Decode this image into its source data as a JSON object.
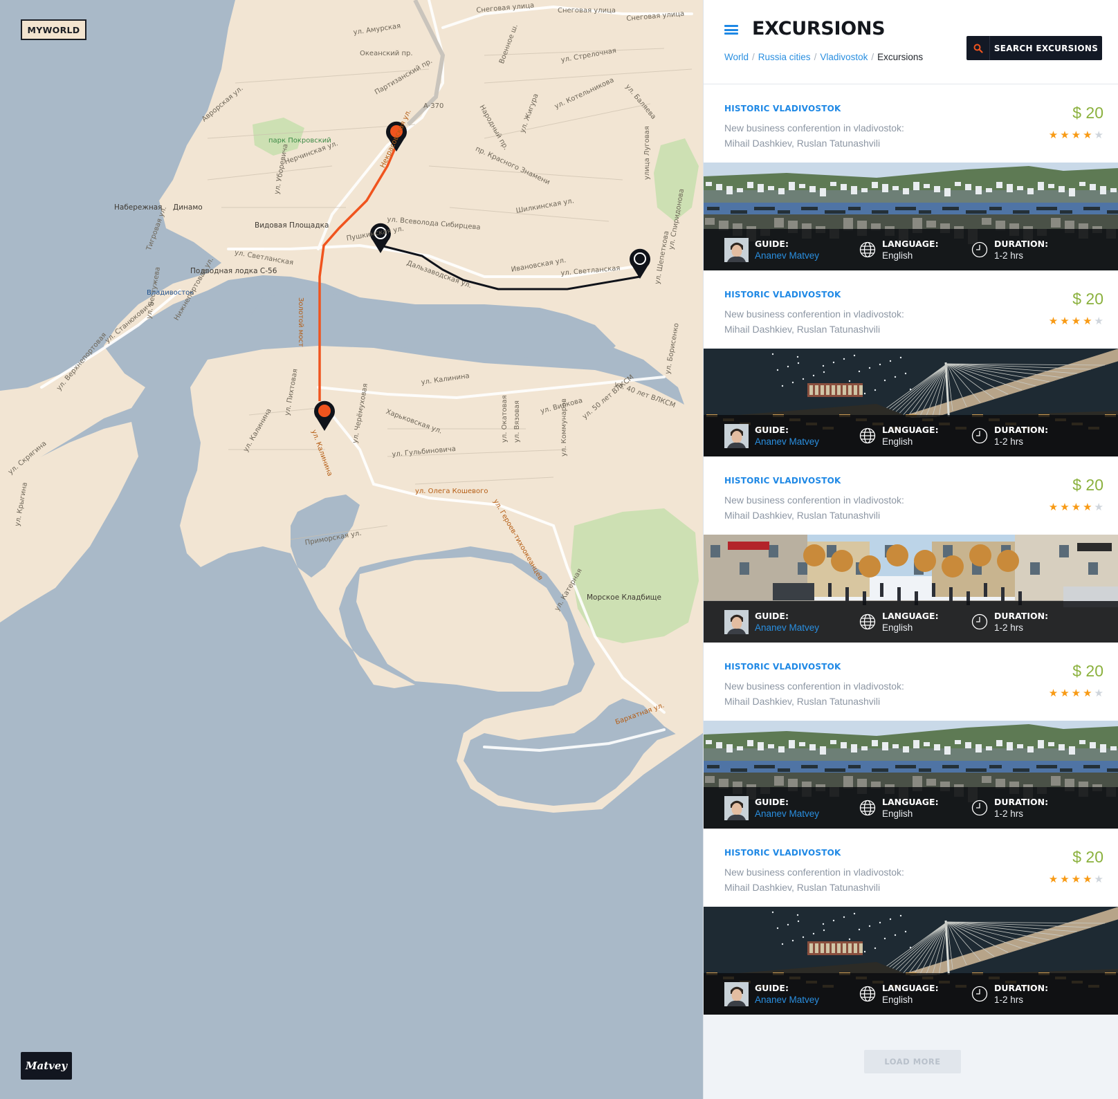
{
  "map": {
    "logo": "MYWORLD",
    "signature": "Matvey",
    "labels": [
      "Снеговая улица",
      "Снеговая улица",
      "Снеговая улица",
      "ул. Амурская",
      "Океанский пр.",
      "Партизанский пр.",
      "A-370",
      "Аврорская ул.",
      "парк Покровский",
      "Нерчинская ул.",
      "Набережная",
      "Динамо",
      "Видовая Площадка",
      "Пушкинская ул.",
      "ул. Светланская",
      "Подводная лодка С-56",
      "Владивосток",
      "Некрасовская ул.",
      "ул. Всеволода Сибирцева",
      "Дальзаводская ул.",
      "Ивановская ул.",
      "ул. Светланская",
      "ул. Котельникова",
      "Народный пр.",
      "пр. Красного Знамени",
      "ул. Стрелочная",
      "Шилкинская ул.",
      "улица Луговая",
      "ул. Калинина",
      "Харьковская ул.",
      "ул. Гульбиновича",
      "ул. Черёмуховая",
      "ул. Калинина",
      "ул. Олега Кошевого",
      "ул. Героев-тихоокеанцев",
      "Приморская ул.",
      "Морское Кладбище",
      "Бархатная ул.",
      "ул. Вилкова",
      "ул. 50 лет ВЛКСМ",
      "ул. 40 лет ВЛКСМ",
      "ул. Окатовая",
      "ул. Вязовая",
      "ул. Коммунаров",
      "ул. Верхнепортовая",
      "ул. Станюковича",
      "ул. Бестужева",
      "Нижнепортовая ул.",
      "ул. Скрягина",
      "ул. Крыгина",
      "ул. Катерная",
      "Золотой мост",
      "ул. Пихтовая",
      "ул. Калинина",
      "Тигровая ул.",
      "ул. Уборевича",
      "Военное ш.",
      "ул. Жигура",
      "ул. Баляева",
      "ул. Борисенко",
      "ул. Спиридонова",
      "ул. Шепеткова"
    ]
  },
  "panel": {
    "title": "EXCURSIONS",
    "breadcrumb": [
      "World",
      "Russia cities",
      "Vladivostok",
      "Excursions"
    ],
    "search_label": "SEARCH EXCURSIONS",
    "load_more": "LOAD MORE",
    "accent": "#1e88e5",
    "price_color": "#8bb13e",
    "star_color": "#f89a14",
    "cards": [
      {
        "title": "HISTORIC VLADIVOSTOK",
        "desc1": "New business conferention in vladivostok:",
        "desc2": "Mihail Dashkiev, Ruslan Tatunashvili",
        "price": "$ 20",
        "rating": 4,
        "guide_label": "GUIDE:",
        "guide": "Ananev Matvey",
        "language_label": "LANGUAGE:",
        "language": "English",
        "duration_label": "DURATION:",
        "duration": "1-2 hrs",
        "photo": "harbor"
      },
      {
        "title": "HISTORIC VLADIVOSTOK",
        "desc1": "New business conferention in vladivostok:",
        "desc2": "Mihail Dashkiev, Ruslan Tatunashvili",
        "price": "$ 20",
        "rating": 4,
        "guide_label": "GUIDE:",
        "guide": "Ananev Matvey",
        "language_label": "LANGUAGE:",
        "language": "English",
        "duration_label": "DURATION:",
        "duration": "1-2 hrs",
        "photo": "bridge"
      },
      {
        "title": "HISTORIC VLADIVOSTOK",
        "desc1": "New business conferention in vladivostok:",
        "desc2": "Mihail Dashkiev, Ruslan Tatunashvili",
        "price": "$ 20",
        "rating": 4,
        "guide_label": "GUIDE:",
        "guide": "Ananev Matvey",
        "language_label": "LANGUAGE:",
        "language": "English",
        "duration_label": "DURATION:",
        "duration": "1-2 hrs",
        "photo": "street"
      },
      {
        "title": "HISTORIC VLADIVOSTOK",
        "desc1": "New business conferention in vladivostok:",
        "desc2": "Mihail Dashkiev, Ruslan Tatunashvili",
        "price": "$ 20",
        "rating": 4,
        "guide_label": "GUIDE:",
        "guide": "Ananev Matvey",
        "language_label": "LANGUAGE:",
        "language": "English",
        "duration_label": "DURATION:",
        "duration": "1-2 hrs",
        "photo": "harbor"
      },
      {
        "title": "HISTORIC VLADIVOSTOK",
        "desc1": "New business conferention in vladivostok:",
        "desc2": "Mihail Dashkiev, Ruslan Tatunashvili",
        "price": "$ 20",
        "rating": 4,
        "guide_label": "GUIDE:",
        "guide": "Ananev Matvey",
        "language_label": "LANGUAGE:",
        "language": "English",
        "duration_label": "DURATION:",
        "duration": "1-2 hrs",
        "photo": "bridge"
      }
    ]
  }
}
